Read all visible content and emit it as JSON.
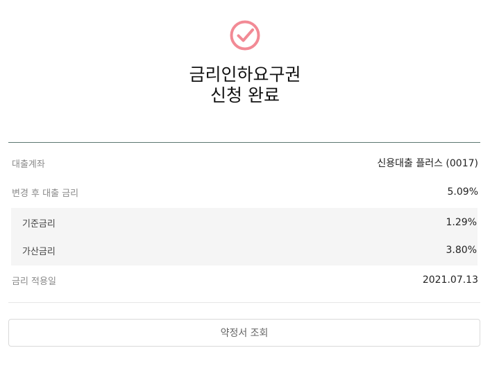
{
  "status": {
    "icon": "check-circle-icon",
    "icon_color": "#f28a95",
    "title_line1": "금리인하요구권",
    "title_line2": "신청 완료"
  },
  "details": {
    "loan_account": {
      "label": "대출계좌",
      "value": "신용대출 플러스 (0017)"
    },
    "changed_rate": {
      "label": "변경 후 대출 금리",
      "value": "5.09%"
    },
    "base_rate": {
      "label": "기준금리",
      "value": "1.29%"
    },
    "added_rate": {
      "label": "가산금리",
      "value": "3.80%"
    },
    "apply_date": {
      "label": "금리 적용일",
      "value": "2021.07.13"
    }
  },
  "actions": {
    "contract_button_label": "약정서 조회"
  }
}
